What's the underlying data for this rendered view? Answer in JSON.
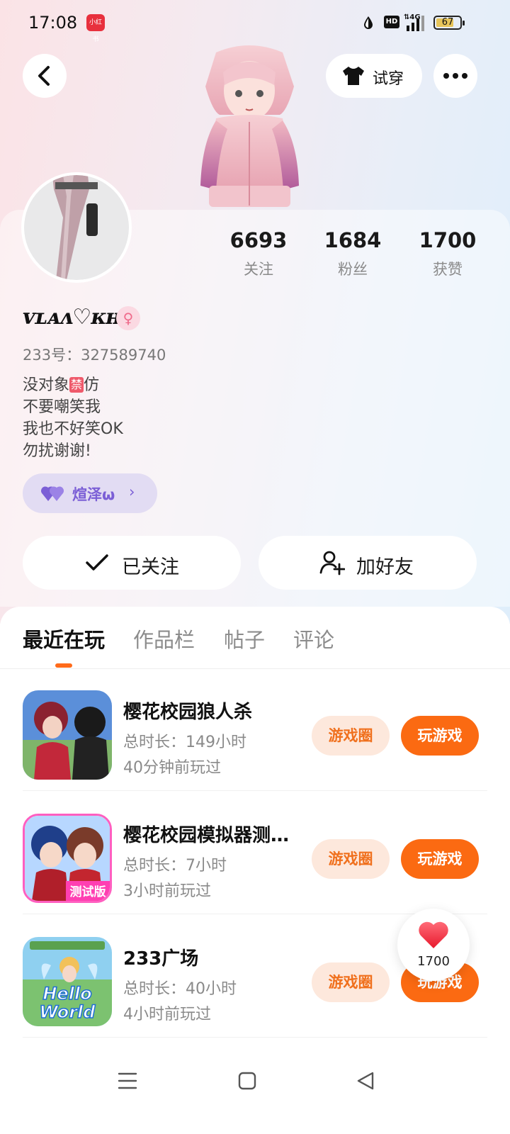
{
  "status_bar": {
    "time": "17:08",
    "battery": "67",
    "network": "4G",
    "hd": "HD"
  },
  "header": {
    "try_on_label": "试穿"
  },
  "profile": {
    "stats": [
      {
        "value": "6693",
        "label": "关注"
      },
      {
        "value": "1684",
        "label": "粉丝"
      },
      {
        "value": "1700",
        "label": "获赞"
      }
    ],
    "nickname": "ᴠʟᴀᴧ♡ᴋʜ",
    "uid": "233号：327589740",
    "bio": {
      "line1_prefix": "没对象",
      "line1_badge": "禁",
      "line1_suffix": "仿",
      "line2": "不要嘲笑我",
      "line3": "我也不好笑OK",
      "line4": "勿扰谢谢!"
    },
    "cp_name": "煊泽ω",
    "follow_label": "已关注",
    "add_friend_label": "加好友"
  },
  "tabs": [
    {
      "label": "最近在玩",
      "active": true
    },
    {
      "label": "作品栏",
      "active": false
    },
    {
      "label": "帖子",
      "active": false
    },
    {
      "label": "评论",
      "active": false
    }
  ],
  "games": [
    {
      "title": "樱花校园狼人杀",
      "duration": "总时长：149小时",
      "last_played": "40分钟前玩过",
      "circle_label": "游戏圈",
      "play_label": "玩游戏"
    },
    {
      "title": "樱花校园模拟器测试版",
      "duration": "总时长：7小时",
      "last_played": "3小时前玩过",
      "circle_label": "游戏圈",
      "play_label": "玩游戏",
      "icon_badge": "测试版"
    },
    {
      "title": "233广场",
      "duration": "总时长：40小时",
      "last_played": "4小时前玩过",
      "circle_label": "游戏圈",
      "play_label": "玩游戏",
      "icon_text": "Hello World"
    }
  ],
  "floating_like": {
    "count": "1700"
  },
  "colors": {
    "accent_orange": "#fb6a12",
    "circle_bg": "#fde8dc",
    "cp_purple": "#7b5fd6"
  }
}
